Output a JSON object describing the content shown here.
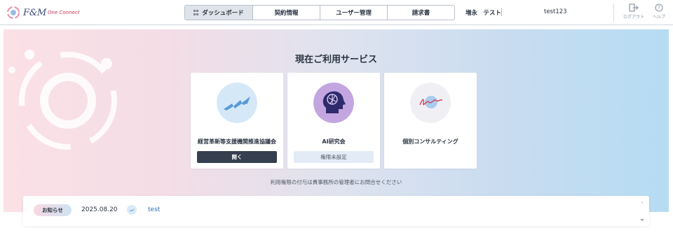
{
  "header": {
    "logo_text": "F&M",
    "logo_sub": "One Connect",
    "tabs": [
      {
        "label": "ダッシュボード"
      },
      {
        "label": "契約情報"
      },
      {
        "label": "ユーザー管理"
      },
      {
        "label": "請求書"
      }
    ],
    "user_name": "増永　テスト",
    "user_id": "test123",
    "logout_label": "ログアウト",
    "help_label": "ヘルプ"
  },
  "hero": {
    "title": "現在ご利用サービス",
    "cards": [
      {
        "name": "経営革新等支援機関推進協議会",
        "button": "開く",
        "icon": "chart-mountain-icon"
      },
      {
        "name": "AI研究会",
        "button": "権限未設定",
        "icon": "ai-brain-icon"
      },
      {
        "name": "個別コンサルティング",
        "icon": "consulting-signature-icon"
      }
    ],
    "notice": "利用権限の付与は貴事務所の管理者にお問合せください"
  },
  "news": {
    "badge": "お知らせ",
    "items": [
      {
        "date": "2025.08.20",
        "title": "test",
        "icon": "service-logo-icon"
      }
    ]
  },
  "colors": {
    "dark_button": "#363f4f",
    "link": "#2a6fb8",
    "hero_left": "#fbe1e6",
    "hero_right": "#b5dcf3"
  }
}
